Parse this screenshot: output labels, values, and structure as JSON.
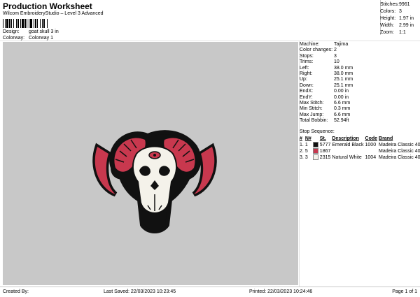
{
  "header": {
    "title": "Production Worksheet",
    "subtitle": "Wilcom EmbroideryStudio – Level 3 Advanced"
  },
  "design": {
    "label": "Design:",
    "value": "goat skull 3 in"
  },
  "colorway": {
    "label": "Colorway:",
    "value": "Colorway 1"
  },
  "stats": [
    {
      "label": "Stitches:",
      "value": "9961"
    },
    {
      "label": "Colors:",
      "value": "3"
    },
    {
      "label": "Height:",
      "value": "1.97 in"
    },
    {
      "label": "Width:",
      "value": "2.99 in"
    },
    {
      "label": "Zoom:",
      "value": "1:1"
    }
  ],
  "info": [
    {
      "label": "Machine:",
      "value": "Tajima"
    },
    {
      "label": "Color changes:",
      "value": "2"
    },
    {
      "label": "Stops:",
      "value": "3"
    },
    {
      "label": "Trims:",
      "value": "10"
    },
    {
      "label": "Left:",
      "value": "38.0 mm"
    },
    {
      "label": "Right:",
      "value": "38.0 mm"
    },
    {
      "label": "Up:",
      "value": "25.1 mm"
    },
    {
      "label": "Down:",
      "value": "25.1 mm"
    },
    {
      "label": "EndX:",
      "value": "0.00 in"
    },
    {
      "label": "EndY:",
      "value": "0.00 in"
    },
    {
      "label": "Max Stitch:",
      "value": "6.6 mm"
    },
    {
      "label": "Min Stitch:",
      "value": "0.3 mm"
    },
    {
      "label": "Max Jump:",
      "value": "6.6 mm"
    },
    {
      "label": "Total Bobbin:",
      "value": "52.94ft"
    }
  ],
  "stop_sequence": {
    "heading": "Stop Sequence:",
    "columns": [
      "#",
      "N#",
      "St.",
      "Description",
      "Code",
      "Brand"
    ],
    "rows": [
      {
        "num": "1.",
        "n": "1",
        "color": "#111111",
        "st": "5777",
        "desc": "Emerald Black",
        "code": "1000",
        "brand": "Madeira Classic 40"
      },
      {
        "num": "2.",
        "n": "5",
        "color": "#c8384e",
        "st": "1867",
        "desc": "",
        "code": "",
        "brand": "Madeira Classic 40"
      },
      {
        "num": "3.",
        "n": "3",
        "color": "#f4f2ea",
        "st": "2315",
        "desc": "Natural White",
        "code": "1004",
        "brand": "Madeira Classic 40"
      }
    ]
  },
  "footer": {
    "created_by": "Created By:",
    "last_saved": "Last Saved: 22/03/2023 10:23:45",
    "printed": "Printed: 22/03/2023 10:24:46",
    "page": "Page 1 of 1"
  },
  "preview": {
    "background": "#c8c8c8",
    "horn_color": "#c8384e",
    "outline_color": "#111111",
    "skull_color": "#f4f2ea"
  }
}
